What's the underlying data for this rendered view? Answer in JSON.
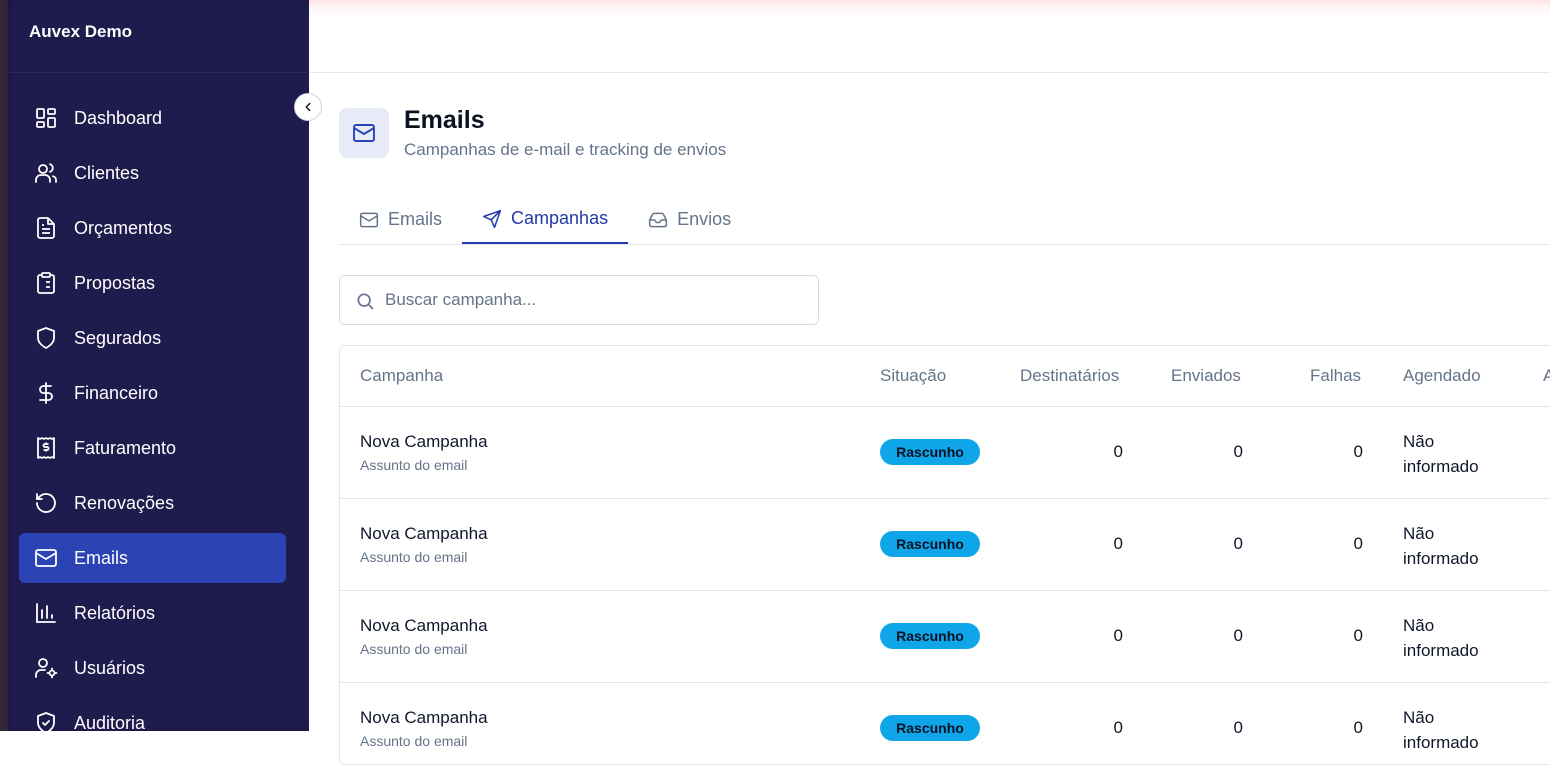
{
  "brand": "Auvex Demo",
  "sidebar": {
    "items": [
      {
        "label": "Dashboard",
        "icon": "dashboard-icon"
      },
      {
        "label": "Clientes",
        "icon": "users-icon"
      },
      {
        "label": "Orçamentos",
        "icon": "document-icon"
      },
      {
        "label": "Propostas",
        "icon": "clipboard-icon"
      },
      {
        "label": "Segurados",
        "icon": "shield-icon"
      },
      {
        "label": "Financeiro",
        "icon": "dollar-icon"
      },
      {
        "label": "Faturamento",
        "icon": "receipt-icon"
      },
      {
        "label": "Renovações",
        "icon": "rotate-icon"
      },
      {
        "label": "Emails",
        "icon": "mail-icon",
        "active": true
      },
      {
        "label": "Relatórios",
        "icon": "bar-chart-icon"
      },
      {
        "label": "Usuários",
        "icon": "user-cog-icon"
      },
      {
        "label": "Auditoria",
        "icon": "shield-check-icon"
      }
    ]
  },
  "header": {
    "title": "Emails",
    "subtitle": "Campanhas de e-mail e tracking de envios",
    "icon": "mail-icon"
  },
  "tabs": [
    {
      "label": "Emails",
      "icon": "mail-icon"
    },
    {
      "label": "Campanhas",
      "icon": "send-icon",
      "active": true
    },
    {
      "label": "Envios",
      "icon": "inbox-icon"
    }
  ],
  "search": {
    "placeholder": "Buscar campanha...",
    "value": ""
  },
  "table": {
    "columns": [
      "Campanha",
      "Situação",
      "Destinatários",
      "Enviados",
      "Falhas",
      "Agendado",
      "A"
    ],
    "rows": [
      {
        "name": "Nova Campanha",
        "subject": "Assunto do email",
        "status": "Rascunho",
        "recipients": "0",
        "sent": "0",
        "failures": "0",
        "scheduled_1": "Não",
        "scheduled_2": "informado"
      },
      {
        "name": "Nova Campanha",
        "subject": "Assunto do email",
        "status": "Rascunho",
        "recipients": "0",
        "sent": "0",
        "failures": "0",
        "scheduled_1": "Não",
        "scheduled_2": "informado"
      },
      {
        "name": "Nova Campanha",
        "subject": "Assunto do email",
        "status": "Rascunho",
        "recipients": "0",
        "sent": "0",
        "failures": "0",
        "scheduled_1": "Não",
        "scheduled_2": "informado"
      },
      {
        "name": "Nova Campanha",
        "subject": "Assunto do email",
        "status": "Rascunho",
        "recipients": "0",
        "sent": "0",
        "failures": "0",
        "scheduled_1": "Não",
        "scheduled_2": "informado"
      }
    ]
  },
  "colors": {
    "sidebar_bg": "#1f1b4d",
    "active_item": "#2c43b5",
    "accent": "#233aa8",
    "badge": "#0ea5e9"
  }
}
